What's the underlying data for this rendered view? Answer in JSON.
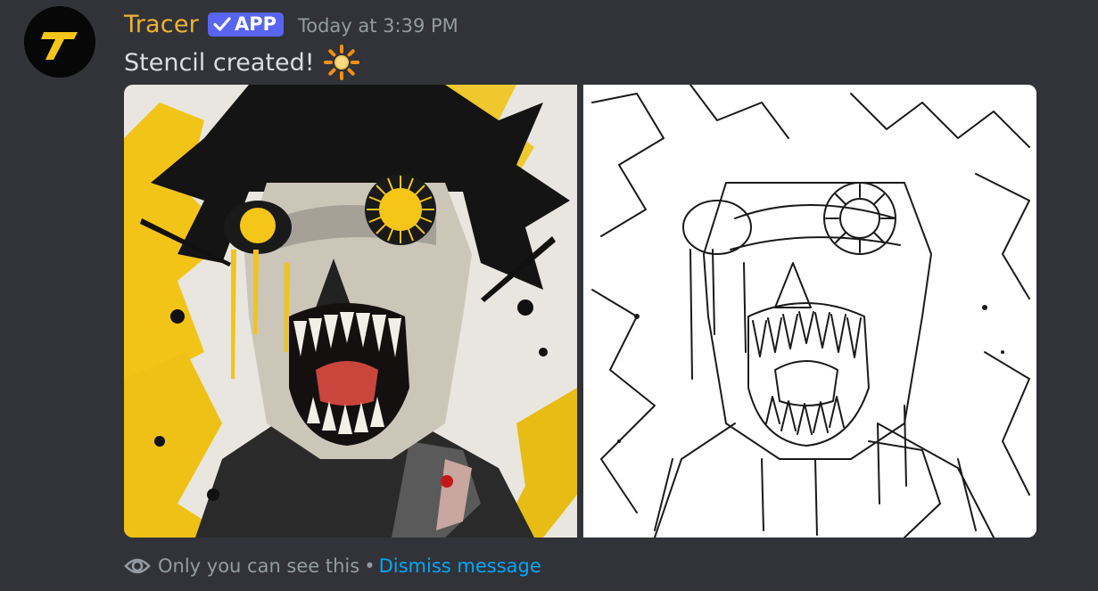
{
  "author": {
    "name": "Tracer",
    "badge_label": "APP",
    "timestamp": "Today at 3:39 PM",
    "avatar_letter": "T"
  },
  "message": {
    "text": "Stencil created!",
    "emoji_icon": "sun-icon"
  },
  "attachments": [
    {
      "name": "zombie-illustration-color",
      "kind": "color artwork (yellow and black)"
    },
    {
      "name": "zombie-stencil-lineart",
      "kind": "black line-art stencil"
    }
  ],
  "ephemeral": {
    "notice": "Only you can see this",
    "separator": "•",
    "dismiss_label": "Dismiss message",
    "icon": "eye-icon"
  },
  "colors": {
    "background": "#313338",
    "username": "#f0b232",
    "badge": "#5865f2",
    "link": "#00a8fc",
    "muted": "#949ba4",
    "text": "#dbdee1",
    "brand_yellow": "#f5c518"
  }
}
